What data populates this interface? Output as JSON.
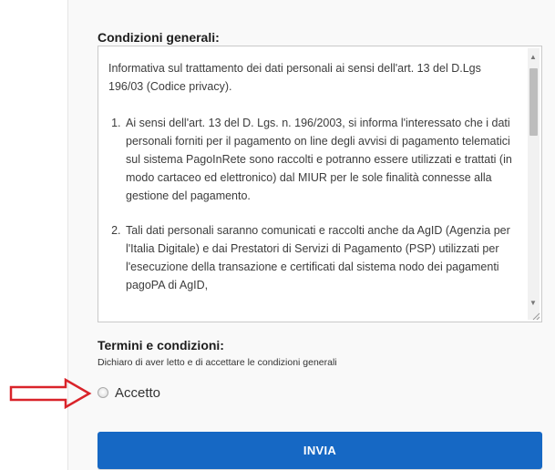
{
  "general_conditions": {
    "title": "Condizioni generali:",
    "intro": "Informativa sul trattamento dei dati personali ai sensi dell'art. 13 del D.Lgs 196/03 (Codice privacy).",
    "items": [
      "Ai sensi dell'art. 13 del D. Lgs. n. 196/2003, si informa l'interessato che i dati personali forniti per il pagamento on line degli avvisi di pagamento telematici sul sistema PagoInRete sono raccolti e potranno essere utilizzati e trattati (in modo cartaceo ed elettronico) dal MIUR per le sole finalità connesse alla gestione del pagamento.",
      "Tali dati personali saranno comunicati e raccolti anche da AgID (Agenzia per l'Italia Digitale) e dai Prestatori di Servizi di Pagamento (PSP) utilizzati per l'esecuzione della transazione e certificati dal sistema nodo dei pagamenti pagoPA di AgID,"
    ],
    "scroll_position": 0.0
  },
  "terms": {
    "title": "Termini e condizioni:",
    "description": "Dichiaro di aver letto e di accettare le condizioni generali",
    "accept_label": "Accetto",
    "accept_checked": false
  },
  "actions": {
    "submit_label": "INVIA",
    "submit_color": "#1668c4"
  },
  "annotation": {
    "arrow_color": "#d9232a"
  }
}
